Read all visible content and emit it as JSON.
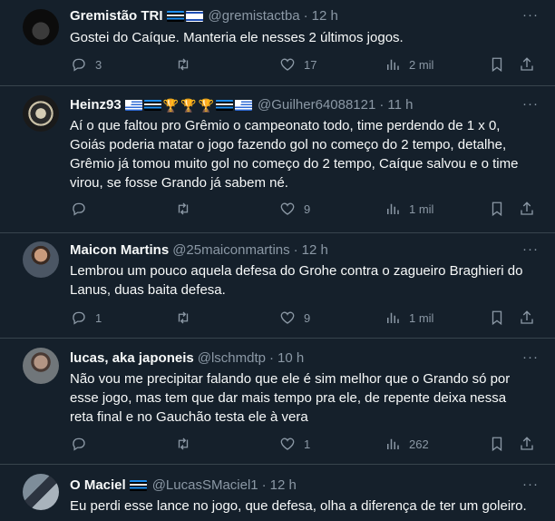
{
  "tweets": [
    {
      "name": "Gremistão TRI",
      "badges": [
        "grem",
        "isr"
      ],
      "handle": "@gremistactba",
      "time": "12 h",
      "text": "Gostei do Caíque. Manteria ele nesses 2 últimos jogos.",
      "replies": "3",
      "retweets": "",
      "likes": "17",
      "views": "2 mil"
    },
    {
      "name": "Heinz93",
      "badges": [
        "uru",
        "grem",
        "trophy",
        "trophy",
        "trophy",
        "grem",
        "uru"
      ],
      "handle": "@Guilher64088121",
      "time": "11 h",
      "text": "Aí o que faltou pro Grêmio o campeonato todo, time perdendo de 1 x 0, Goiás poderia matar o jogo fazendo gol no começo do 2 tempo, detalhe, Grêmio já tomou muito gol no começo do 2 tempo, Caíque salvou e o time virou, se fosse Grando já sabem né.",
      "replies": "",
      "retweets": "",
      "likes": "9",
      "views": "1 mil"
    },
    {
      "name": "Maicon Martins",
      "badges": [],
      "handle": "@25maiconmartins",
      "time": "12 h",
      "text": "Lembrou um pouco aquela defesa do Grohe contra o zagueiro Braghieri do Lanus, duas baita defesa.",
      "replies": "1",
      "retweets": "",
      "likes": "9",
      "views": "1 mil"
    },
    {
      "name": "lucas, aka japoneis",
      "badges": [],
      "handle": "@lschmdtp",
      "time": "10 h",
      "text": "Não vou me precipitar falando que ele é sim melhor que o Grando só por esse jogo, mas tem que dar mais tempo pra ele, de repente deixa nessa reta final e no Gauchão testa ele à vera",
      "replies": "",
      "retweets": "",
      "likes": "1",
      "views": "262"
    },
    {
      "name": "O Maciel",
      "badges": [
        "grem"
      ],
      "handle": "@LucasSMaciel1",
      "time": "12 h",
      "text": "Eu perdi esse lance no jogo, que defesa, olha a diferença de ter um goleiro.",
      "replies": "",
      "retweets": "",
      "likes": "",
      "views": ""
    }
  ],
  "separator": "·",
  "more_label": "···",
  "icons": [
    "reply-icon",
    "retweet-icon",
    "like-icon",
    "views-icon",
    "bookmark-icon",
    "share-icon",
    "more-icon"
  ],
  "colors": {
    "background": "#15202b",
    "text": "#f7f9f9",
    "muted": "#8b98a5",
    "border": "#38444d"
  }
}
